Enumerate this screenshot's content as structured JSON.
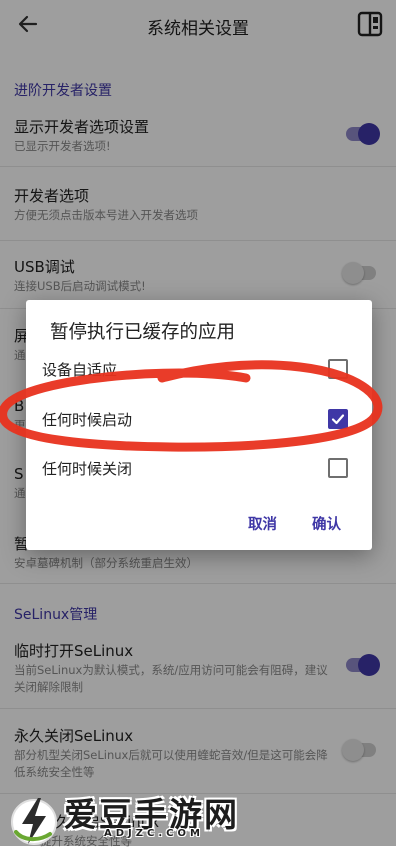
{
  "appbar": {
    "title": "系统相关设置"
  },
  "sections": [
    {
      "title": "进阶开发者设置"
    },
    {
      "title": "SeLinux管理"
    }
  ],
  "items": [
    {
      "title": "显示开发者选项设置",
      "sub": "已显示开发者选项!",
      "switch": "on"
    },
    {
      "title": "开发者选项",
      "sub": "方便无须点击版本号进入开发者选项"
    },
    {
      "title": "USB调试",
      "sub": "连接USB后启动调试模式!",
      "switch": "off"
    },
    {
      "title": "屏",
      "sub": "通"
    },
    {
      "title": "B",
      "sub": "更"
    },
    {
      "title": "S",
      "sub": "通"
    },
    {
      "title": "暂",
      "sub": "安卓墓碑机制（部分系统重启生效）"
    },
    {
      "title": "临时打开SeLinux",
      "sub": "当前SeLinux为默认模式，系统/应用访问可能会有阻碍，建议关闭解除限制",
      "switch": "on"
    },
    {
      "title": "永久关闭SeLinux",
      "sub": "部分机型关闭SeLinux后就可以使用蝰蛇音效/但是这可能会降低系统安全性等",
      "switch": "off"
    },
    {
      "title": "永久开启SeLinux",
      "sub": "提升系统安全性等"
    }
  ],
  "dialog": {
    "title": "暂停执行已缓存的应用",
    "options": [
      {
        "label": "设备自适应",
        "checked": false
      },
      {
        "label": "任何时候启动",
        "checked": true
      },
      {
        "label": "任何时候关闭",
        "checked": false
      }
    ],
    "cancel": "取消",
    "confirm": "确认"
  },
  "watermark": {
    "text": "爱豆手游网",
    "url": "ADJZC.COM"
  },
  "colors": {
    "accent": "#3F37A6",
    "annotation": "#E8321E"
  }
}
